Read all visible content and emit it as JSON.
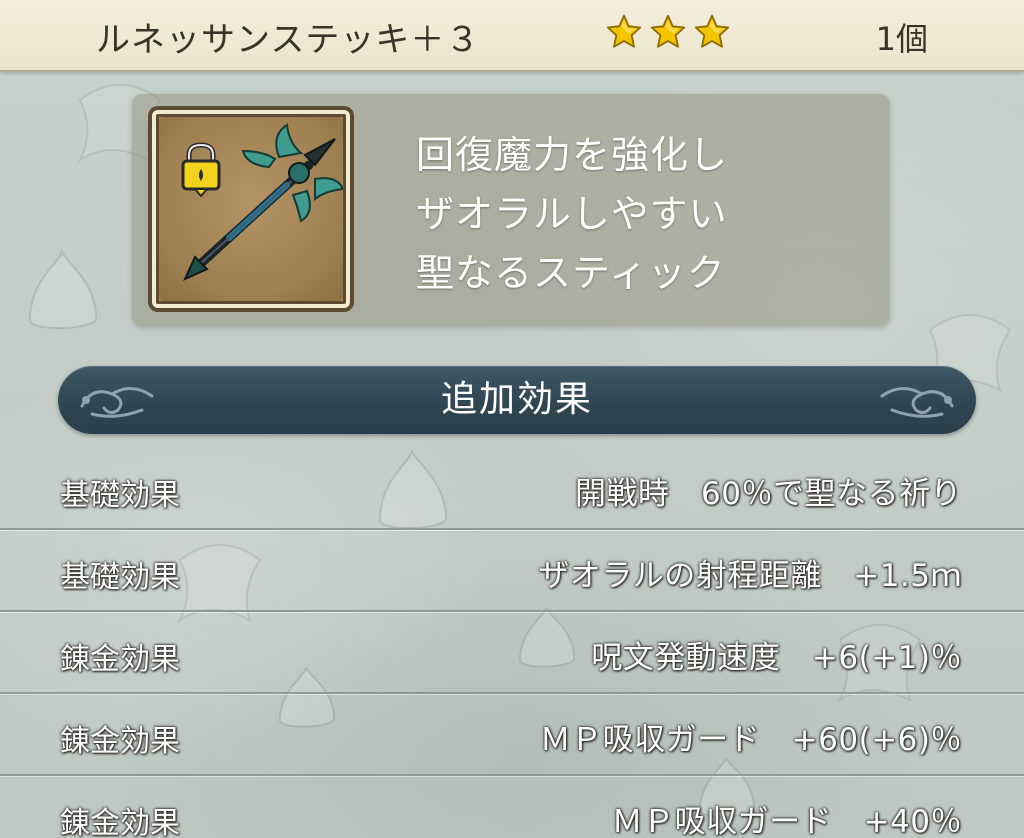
{
  "header": {
    "item_name": "ルネッサンステッキ＋３",
    "rarity_stars": 3,
    "quantity": "1個"
  },
  "item_icon": {
    "icon": "staff-icon",
    "lock_icon": "padlock-icon"
  },
  "description": {
    "lines": [
      "回復魔力を強化し",
      "ザオラルしやすい",
      "聖なるスティック"
    ]
  },
  "section": {
    "title": "追加効果"
  },
  "effects": [
    {
      "type": "基礎効果",
      "value": "開戦時　60％で聖なる祈り"
    },
    {
      "type": "基礎効果",
      "value": "ザオラルの射程距離　+1.5ｍ"
    },
    {
      "type": "錬金効果",
      "value": "呪文発動速度　+6(+1)％"
    },
    {
      "type": "錬金効果",
      "value": "ＭＰ吸収ガード　+60(+6)％"
    },
    {
      "type": "錬金効果",
      "value": "ＭＰ吸収ガード　+40％"
    }
  ],
  "colors": {
    "header_bg": "#ebe4cc",
    "banner_bg": "#2f4653",
    "star": "#f5c400",
    "icon_bg": "#a8895b"
  }
}
